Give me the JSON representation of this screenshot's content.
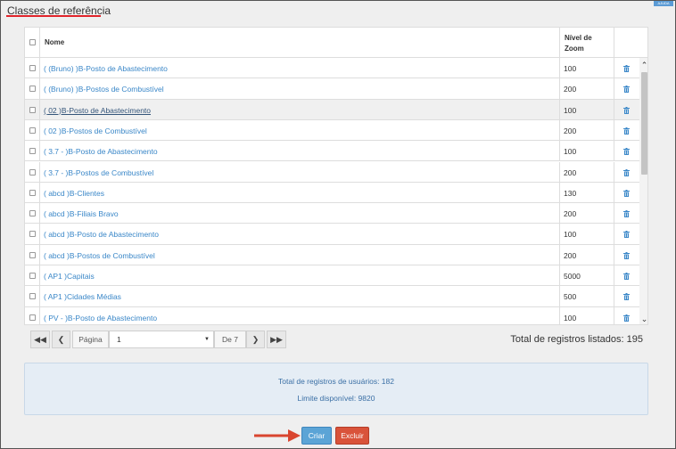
{
  "page": {
    "title": "Classes de referência",
    "corner_label": "AJUDA"
  },
  "table": {
    "headers": {
      "name": "Nome",
      "zoom": "Nível de Zoom"
    },
    "rows": [
      {
        "name": "( (Bruno) )B-Posto de Abastecimento",
        "zoom": "100",
        "highlighted": false
      },
      {
        "name": "( (Bruno) )B-Postos de Combustível",
        "zoom": "200",
        "highlighted": false
      },
      {
        "name": "( 02 )B-Posto de Abastecimento",
        "zoom": "100",
        "highlighted": true
      },
      {
        "name": "( 02 )B-Postos de Combustível",
        "zoom": "200",
        "highlighted": false
      },
      {
        "name": "( 3.7 - )B-Posto de Abastecimento",
        "zoom": "100",
        "highlighted": false
      },
      {
        "name": "( 3.7 - )B-Postos de Combustível",
        "zoom": "200",
        "highlighted": false
      },
      {
        "name": "( abcd )B-Clientes",
        "zoom": "130",
        "highlighted": false
      },
      {
        "name": "( abcd )B-Filiais Bravo",
        "zoom": "200",
        "highlighted": false
      },
      {
        "name": "( abcd )B-Posto de Abastecimento",
        "zoom": "100",
        "highlighted": false
      },
      {
        "name": "( abcd )B-Postos de Combustível",
        "zoom": "200",
        "highlighted": false
      },
      {
        "name": "( AP1 )Capitais",
        "zoom": "5000",
        "highlighted": false
      },
      {
        "name": "( AP1 )Cidades Médias",
        "zoom": "500",
        "highlighted": false
      },
      {
        "name": "( PV - )B-Posto de Abastecimento",
        "zoom": "100",
        "highlighted": false
      }
    ]
  },
  "pager": {
    "page_label": "Página",
    "current_page": "1",
    "of_label": "De 7",
    "total_listed": "Total de registros listados: 195"
  },
  "info": {
    "user_records": "Total de registros de usuários: 182",
    "limit": "Limite disponível: 9820"
  },
  "actions": {
    "create": "Criar",
    "delete": "Excluir"
  },
  "colors": {
    "link": "#3a87c8",
    "create": "#5ba4d6",
    "delete": "#d9533a",
    "accent_underline": "#e0242b"
  }
}
